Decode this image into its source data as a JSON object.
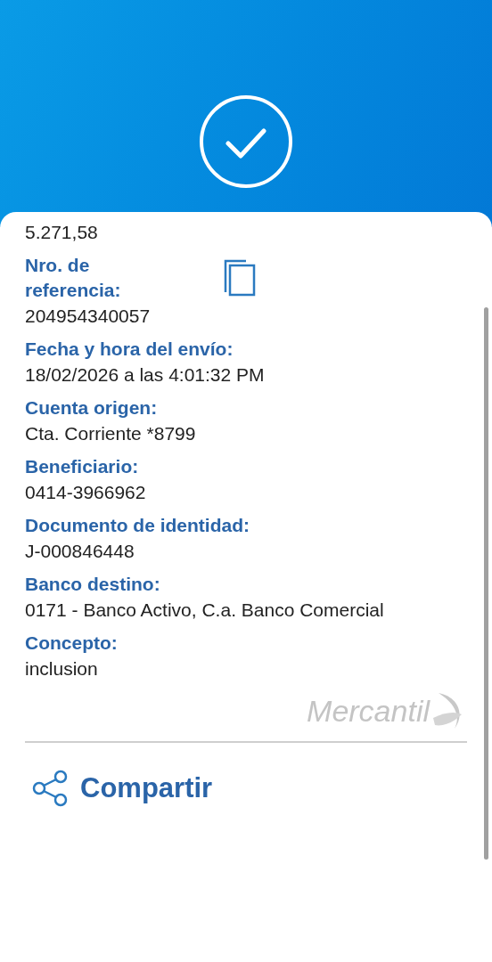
{
  "fields": [
    {
      "value": "5.271,58"
    },
    {
      "label": "Nro. de referencia:",
      "value": "204954340057",
      "copyable": true
    },
    {
      "label": "Fecha y hora del envío:",
      "value": "18/02/2026 a las 4:01:32 PM"
    },
    {
      "label": "Cuenta origen:",
      "value": "Cta. Corriente *8799"
    },
    {
      "label": "Beneficiario:",
      "value": "0414-3966962"
    },
    {
      "label": "Documento de identidad:",
      "value": "J-000846448"
    },
    {
      "label": "Banco destino:",
      "value": "0171 - Banco Activo, C.a. Banco Comercial"
    },
    {
      "label": "Concepto:",
      "value": "inclusion"
    }
  ],
  "logo": {
    "text": "Mercantil"
  },
  "share_button": {
    "label": "Compartir"
  }
}
